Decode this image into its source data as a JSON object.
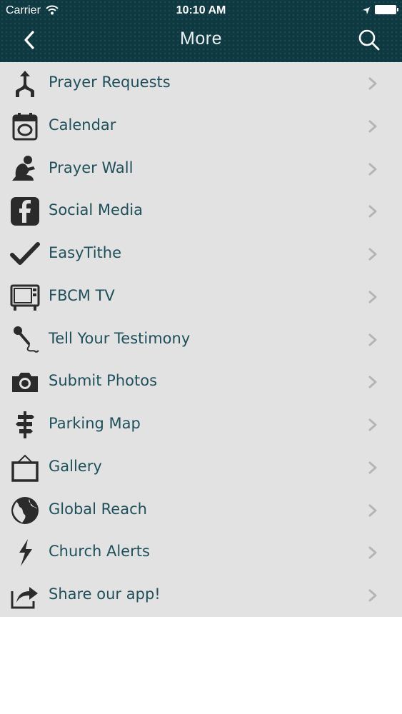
{
  "status_bar": {
    "carrier": "Carrier",
    "time": "10:10 AM"
  },
  "nav": {
    "title": "More"
  },
  "menu": [
    {
      "label": "Prayer Requests",
      "icon": "prayer-requests-icon"
    },
    {
      "label": "Calendar",
      "icon": "calendar-icon"
    },
    {
      "label": "Prayer Wall",
      "icon": "praying-person-icon"
    },
    {
      "label": "Social Media",
      "icon": "facebook-icon"
    },
    {
      "label": "EasyTithe",
      "icon": "checkmark-icon"
    },
    {
      "label": "FBCM TV",
      "icon": "tv-icon"
    },
    {
      "label": "Tell Your Testimony",
      "icon": "microphone-icon"
    },
    {
      "label": "Submit Photos",
      "icon": "camera-icon"
    },
    {
      "label": "Parking Map",
      "icon": "signpost-icon"
    },
    {
      "label": "Gallery",
      "icon": "picture-frame-icon"
    },
    {
      "label": "Global Reach",
      "icon": "globe-icon"
    },
    {
      "label": "Church Alerts",
      "icon": "lightning-icon"
    },
    {
      "label": "Share our app!",
      "icon": "share-icon"
    }
  ],
  "colors": {
    "header_bg": "#0f3942",
    "list_bg": "#e2e2e2",
    "label_text": "#1e4f5a",
    "chevron": "#b5b5b5",
    "icon": "#2b2b2b"
  }
}
